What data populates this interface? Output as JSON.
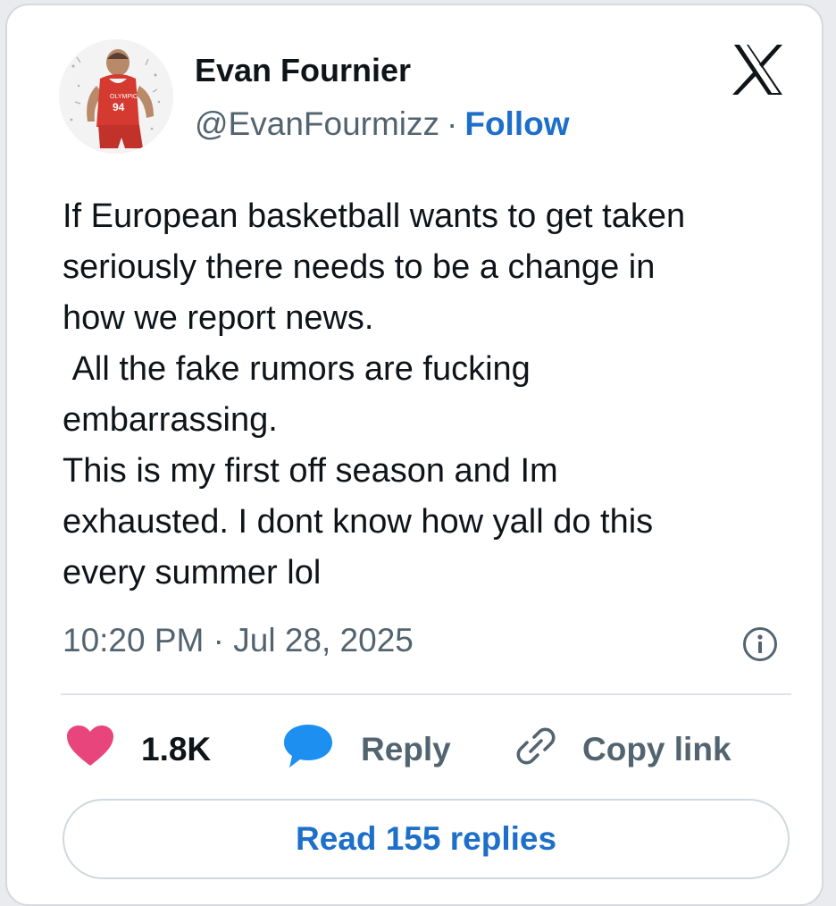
{
  "author": {
    "name": "Evan Fournier",
    "handle": "@EvanFourmizz",
    "separator": "·",
    "follow_label": "Follow",
    "avatar_icon": "player-avatar-icon"
  },
  "brand": {
    "logo_icon": "x-logo-icon"
  },
  "tweet": {
    "text": "If European basketball wants to get taken\nseriously there needs to be a change in\nhow we report news.\n All the fake rumors are fucking\nembarrassing.\nThis is my first off season and Im\nexhausted. I dont know how yall do this\nevery summer lol",
    "timestamp": "10:20 PM · Jul 28, 2025",
    "info_icon": "info-icon"
  },
  "actions": {
    "like_count": "1.8K",
    "like_icon": "heart-icon",
    "reply_label": "Reply",
    "reply_icon": "speech-bubble-icon",
    "copy_label": "Copy link",
    "copy_icon": "link-icon"
  },
  "replies": {
    "label": "Read 155 replies"
  },
  "colors": {
    "accent": "#1d6fc9",
    "heart": "#e8457c",
    "bubble": "#1d8ff0",
    "muted": "#536471",
    "text": "#0f1419"
  }
}
